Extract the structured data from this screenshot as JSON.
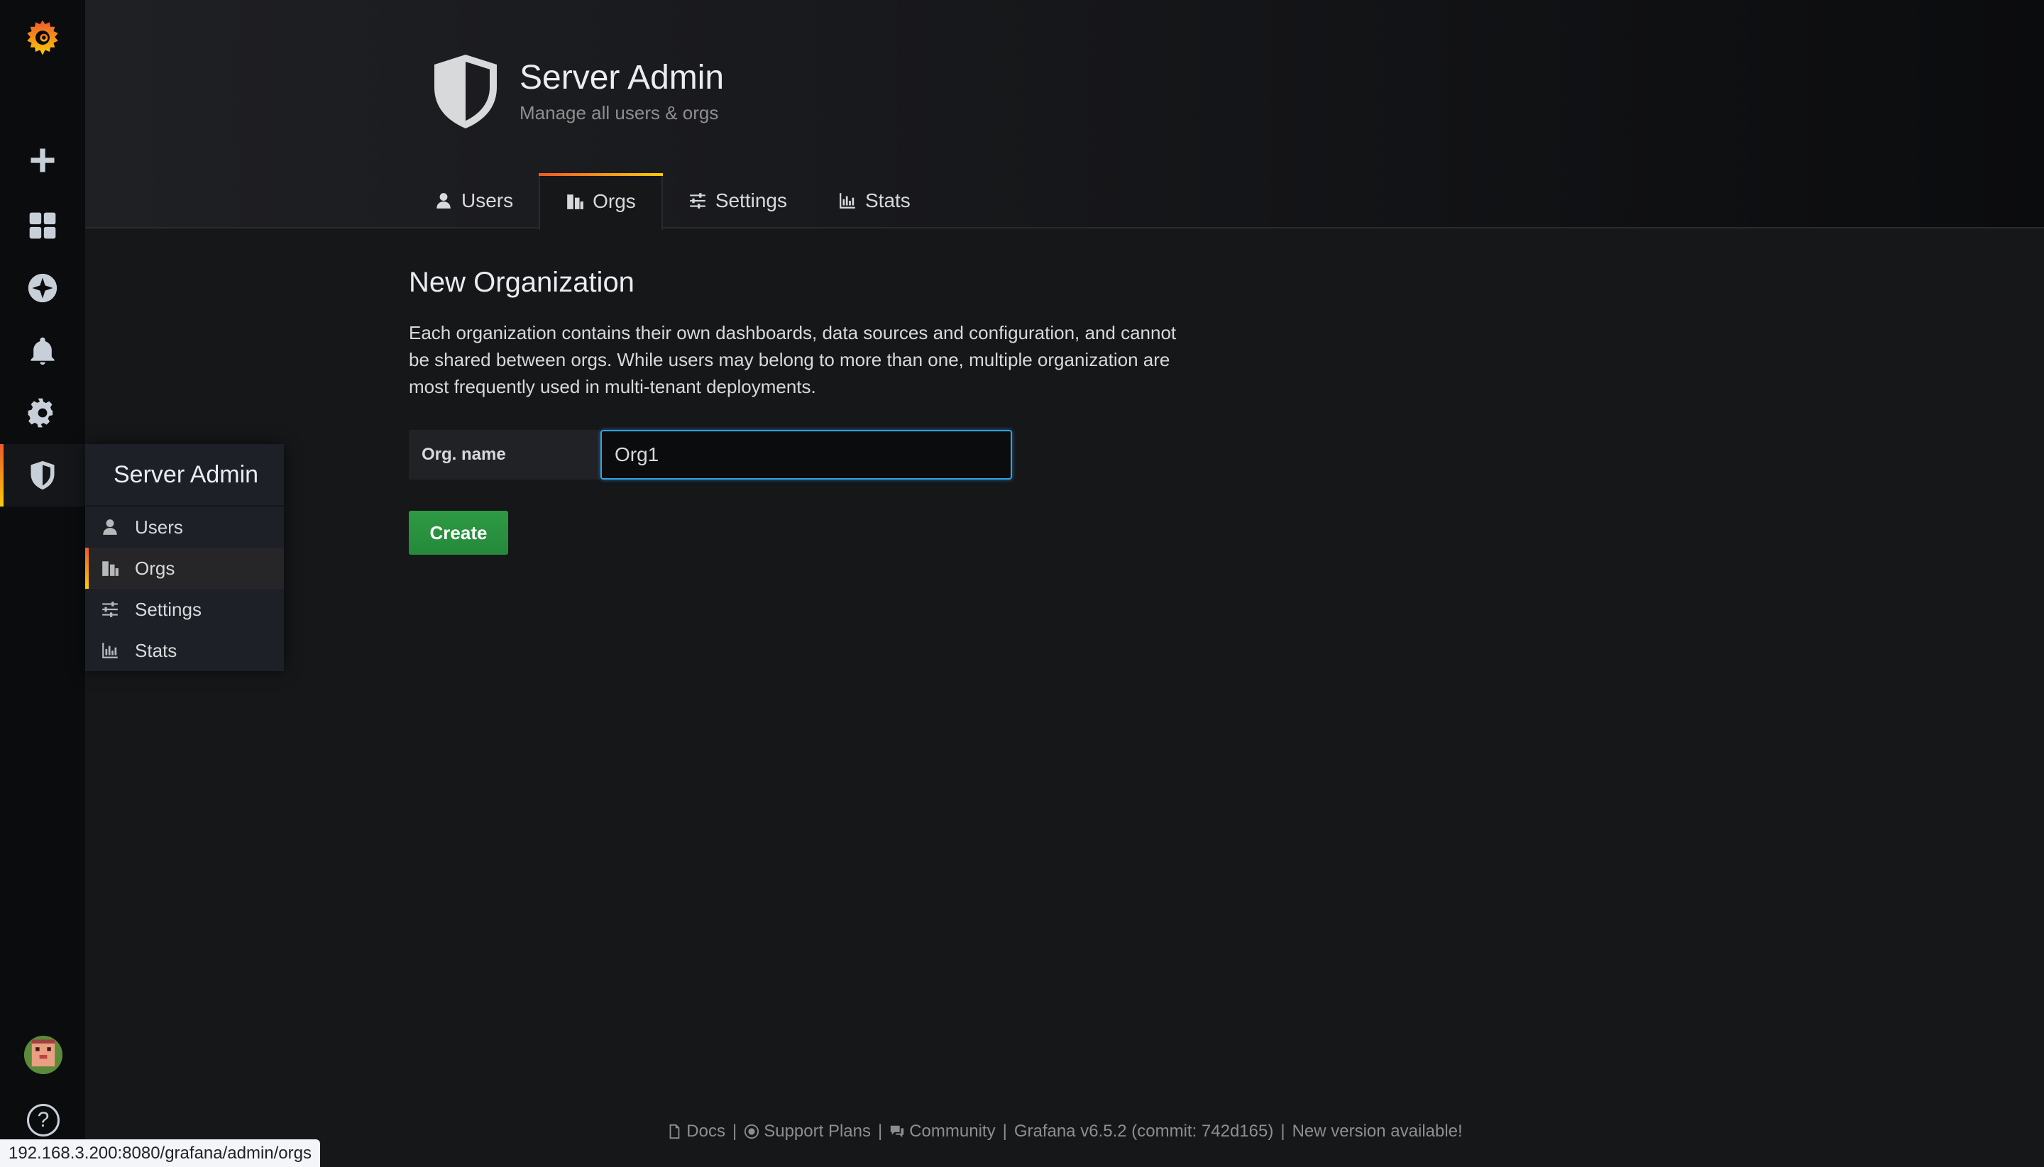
{
  "sidebar": {
    "items": [
      "create",
      "dashboards",
      "explore",
      "alerting",
      "configuration",
      "server-admin"
    ]
  },
  "dropdown": {
    "title": "Server Admin",
    "items": [
      {
        "label": "Users",
        "icon": "user-icon"
      },
      {
        "label": "Orgs",
        "icon": "building-icon"
      },
      {
        "label": "Settings",
        "icon": "sliders-icon"
      },
      {
        "label": "Stats",
        "icon": "bar-chart-icon"
      }
    ]
  },
  "header": {
    "title": "Server Admin",
    "subtitle": "Manage all users & orgs",
    "tabs": [
      {
        "label": "Users"
      },
      {
        "label": "Orgs"
      },
      {
        "label": "Settings"
      },
      {
        "label": "Stats"
      }
    ]
  },
  "main": {
    "title": "New Organization",
    "description": "Each organization contains their own dashboards, data sources and configuration, and cannot be shared between orgs. While users may belong to more than one, multiple organization are most frequently used in multi-tenant deployments.",
    "form": {
      "label": "Org. name",
      "value": "Org1"
    },
    "create_label": "Create"
  },
  "footer": {
    "docs": "Docs",
    "support": "Support Plans",
    "community": "Community",
    "version": "Grafana v6.5.2 (commit: 742d165)",
    "new_version": "New version available!",
    "sep": "|"
  },
  "statusbar": {
    "url": "192.168.3.200:8080/grafana/admin/orgs"
  },
  "colors": {
    "accent_start": "#f05a28",
    "accent_end": "#fbca0a",
    "create_button": "#299c46",
    "input_focus": "#33a2e5"
  }
}
